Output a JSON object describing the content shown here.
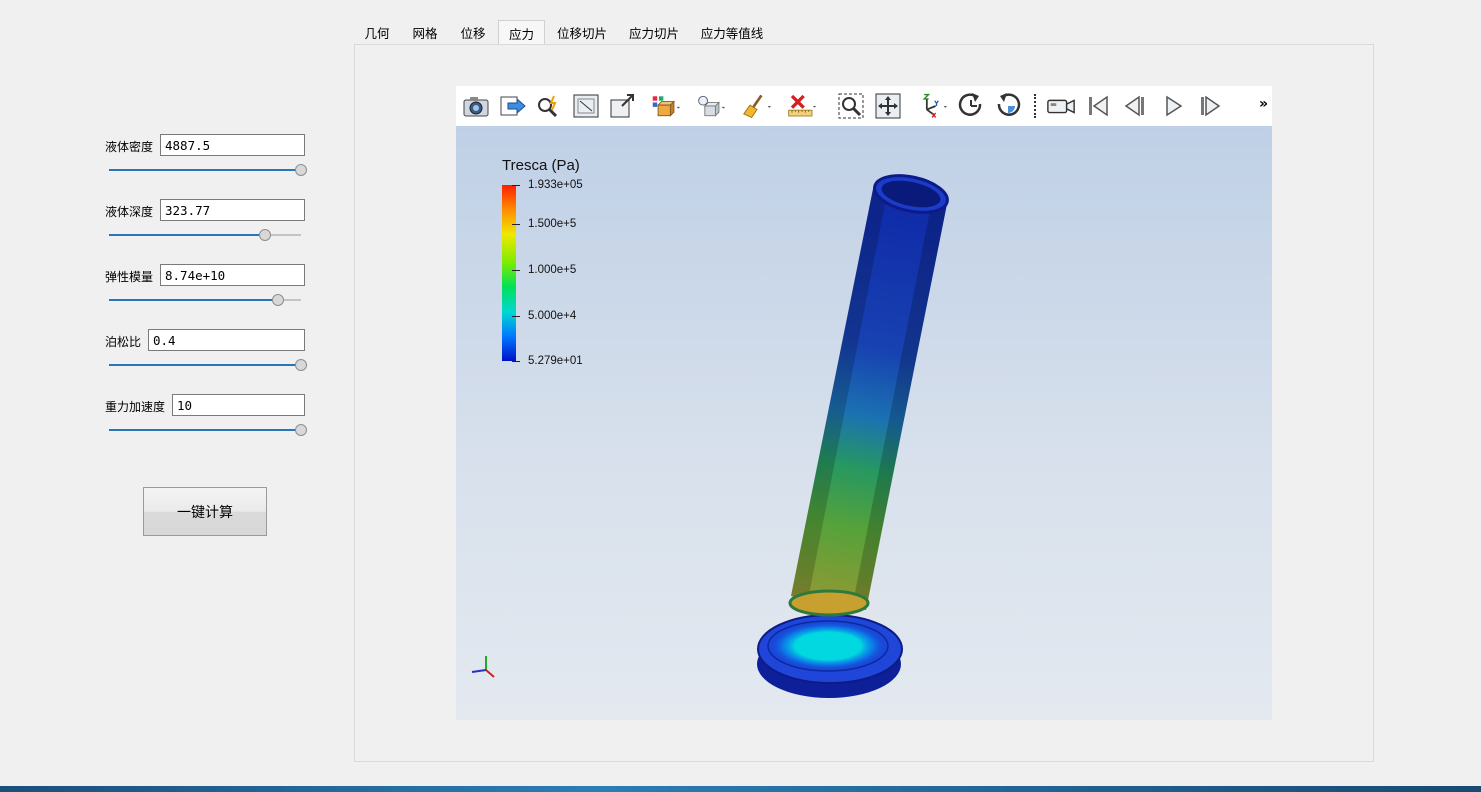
{
  "params": [
    {
      "label": "液体密度",
      "value": "4887.5",
      "slider_fraction": 1.0
    },
    {
      "label": "液体深度",
      "value": "323.77",
      "slider_fraction": 0.81
    },
    {
      "label": "弹性模量",
      "value": "8.74e+10",
      "slider_fraction": 0.88
    },
    {
      "label": "泊松比",
      "value": "0.4",
      "slider_fraction": 1.0
    },
    {
      "label": "重力加速度",
      "value": "10",
      "slider_fraction": 1.0
    }
  ],
  "calc_button_label": "一键计算",
  "tabs": [
    {
      "label": "几何",
      "active": false
    },
    {
      "label": "网格",
      "active": false
    },
    {
      "label": "位移",
      "active": false
    },
    {
      "label": "应力",
      "active": true
    },
    {
      "label": "位移切片",
      "active": false
    },
    {
      "label": "应力切片",
      "active": false
    },
    {
      "label": "应力等值线",
      "active": false
    }
  ],
  "toolbar": {
    "icons": [
      "camera-icon",
      "export-icon",
      "pick-icon",
      "reset-camera-icon",
      "zoom-to-box-icon",
      "representation-icon",
      "light-icon",
      "clear-icon",
      "ruler-icon",
      "zoom-select-icon",
      "fit-icon",
      "axes-orientation-icon",
      "rotate-cw-icon",
      "rotate-ccw-icon",
      "camera-record-icon",
      "first-frame-icon",
      "previous-frame-icon",
      "play-icon",
      "last-frame-icon"
    ],
    "more_label": "»"
  },
  "colorbar": {
    "title": "Tresca (Pa)",
    "labels": [
      "1.933e+05",
      "1.500e+5",
      "1.000e+5",
      "5.000e+4",
      "5.279e+01"
    ],
    "max": 193300,
    "min": 52.79,
    "colors": [
      "#ff1e00",
      "#ff8c00",
      "#f0e800",
      "#7dec00",
      "#00e05a",
      "#00d8d0",
      "#0078ff",
      "#0010c8"
    ]
  },
  "colors": {
    "accent": "#2a74b8",
    "background": "#f0f0f0"
  }
}
